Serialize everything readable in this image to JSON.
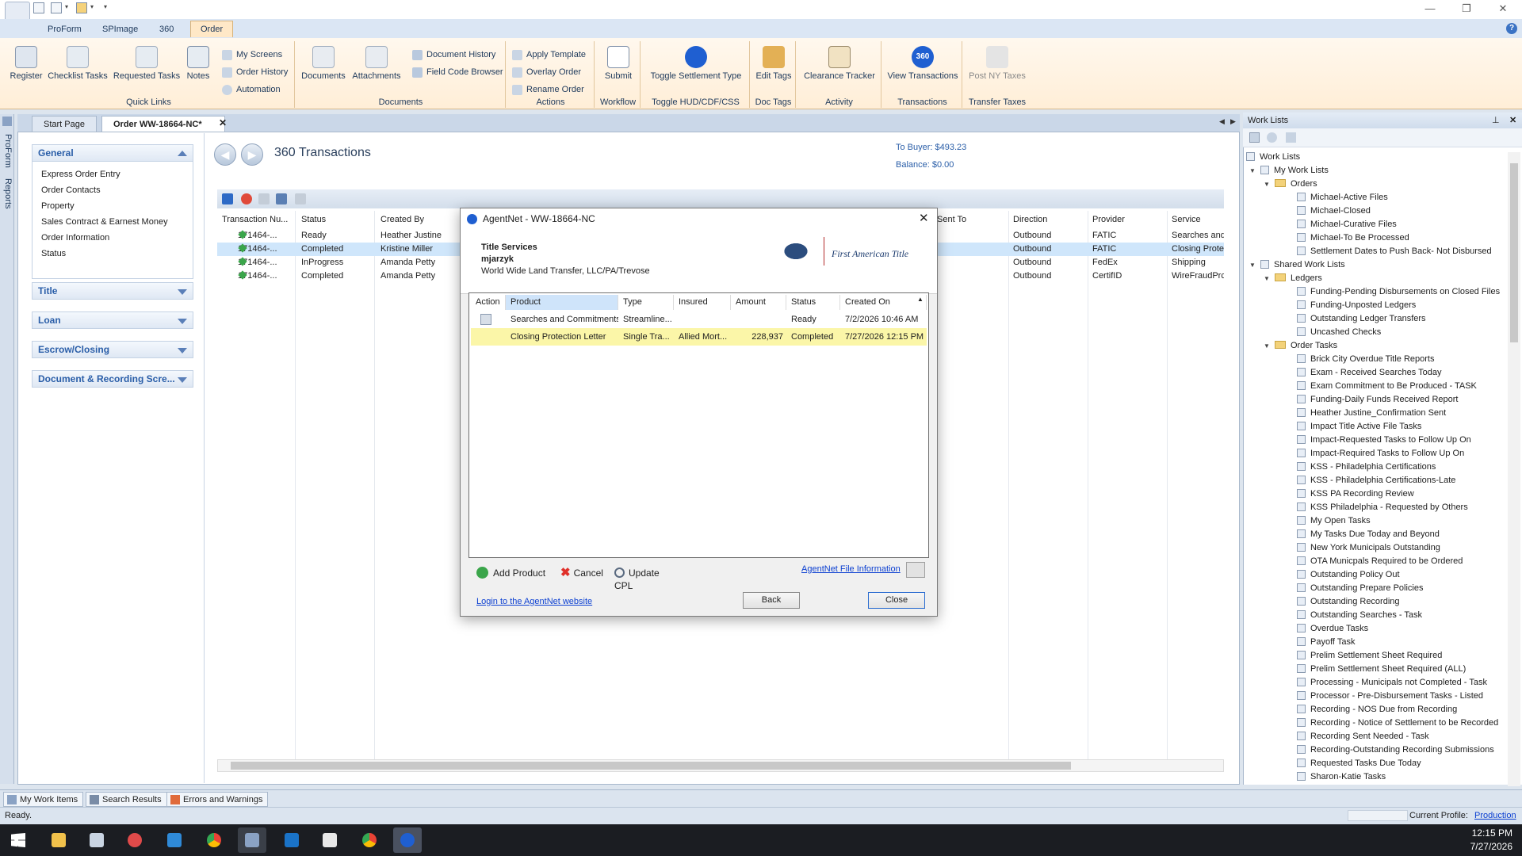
{
  "ribbon_tabs": [
    "ProForm",
    "SPImage",
    "360",
    "Order"
  ],
  "ribbon": {
    "quick_links": {
      "label": "Quick Links",
      "register": "Register",
      "checklist": "Checklist Tasks",
      "requested": "Requested Tasks",
      "notes": "Notes",
      "my_screens": "My Screens",
      "order_history": "Order History",
      "automation": "Automation"
    },
    "documents": {
      "label": "Documents",
      "documents": "Documents",
      "attachments": "Attachments",
      "doc_history": "Document History",
      "field_code": "Field Code Browser"
    },
    "actions": {
      "label": "Actions",
      "apply_template": "Apply Template",
      "overlay_order": "Overlay Order",
      "rename_order": "Rename Order"
    },
    "workflow": {
      "label": "Workflow",
      "submit": "Submit"
    },
    "toggle": {
      "label": "Toggle HUD/CDF/CSS",
      "btn": "Toggle Settlement Type"
    },
    "doc_tags": {
      "label": "Doc Tags",
      "btn": "Edit Tags"
    },
    "activity": {
      "label": "Activity",
      "btn": "Clearance Tracker"
    },
    "transactions": {
      "label": "Transactions",
      "btn": "View Transactions",
      "icon_text": "360"
    },
    "transfer_taxes": {
      "label": "Transfer Taxes",
      "btn": "Post NY Taxes"
    }
  },
  "side_tabs": [
    "ProForm",
    "Reports"
  ],
  "doc_tabs": [
    "Start Page",
    "Order WW-18664-NC*"
  ],
  "nav": {
    "general": {
      "title": "General",
      "items": [
        "Express Order Entry",
        "Order Contacts",
        "Property",
        "Sales Contract & Earnest Money",
        "Order Information",
        "Status"
      ]
    },
    "title": "Title",
    "loan": "Loan",
    "escrow": "Escrow/Closing",
    "docrec": "Document & Recording Scre..."
  },
  "content": {
    "title": "360 Transactions",
    "to_buyer": "To Buyer: $493.23",
    "balance": "Balance: $0.00"
  },
  "grid": {
    "headers": [
      "Transaction Nu...",
      "Status",
      "Created By",
      "Sent To",
      "Direction",
      "Provider",
      "Service"
    ],
    "rows": [
      {
        "num": "171464-...",
        "status": "Ready",
        "by": "Heather Justine",
        "dir": "Outbound",
        "prov": "FATIC",
        "svc": "Searches and"
      },
      {
        "num": "171464-...",
        "status": "Completed",
        "by": "Kristine Miller",
        "dir": "Outbound",
        "prov": "FATIC",
        "svc": "Closing Prote"
      },
      {
        "num": "171464-...",
        "status": "InProgress",
        "by": "Amanda Petty",
        "dir": "Outbound",
        "prov": "FedEx",
        "svc": "Shipping"
      },
      {
        "num": "171464-...",
        "status": "Completed",
        "by": "Amanda Petty",
        "dir": "Outbound",
        "prov": "CertifID",
        "svc": "WireFraudPrc"
      }
    ]
  },
  "worklists": {
    "panel_title": "Work Lists",
    "root": "Work Lists",
    "my": "My Work Lists",
    "orders": "Orders",
    "order_items": [
      "Michael-Active Files",
      "Michael-Closed",
      "Michael-Curative Files",
      "Michael-To Be Processed",
      "Settlement Dates to Push Back- Not Disbursed"
    ],
    "shared": "Shared Work Lists",
    "ledgers": "Ledgers",
    "ledger_items": [
      "Funding-Pending Disbursements on Closed Files",
      "Funding-Unposted Ledgers",
      "Outstanding Ledger Transfers",
      "Uncashed Checks"
    ],
    "order_tasks": "Order Tasks",
    "task_items": [
      "Brick City Overdue Title Reports",
      "Exam - Received Searches Today",
      "Exam Commitment to Be Produced - TASK",
      "Funding-Daily Funds Received Report",
      "Heather Justine_Confirmation Sent",
      "Impact Title Active File Tasks",
      "Impact-Requested Tasks to Follow Up On",
      "Impact-Required Tasks to Follow Up On",
      "KSS - Philadelphia Certifications",
      "KSS - Philadelphia Certifications-Late",
      "KSS PA Recording Review",
      "KSS Philadelphia - Requested by Others",
      "My Open Tasks",
      "My Tasks Due Today and Beyond",
      "New York Municipals Outstanding",
      "OTA Municpals Required to be Ordered",
      "Outstanding Policy Out",
      "Outstanding Prepare Policies",
      "Outstanding Recording",
      "Outstanding Searches - Task",
      "Overdue Tasks",
      "Payoff Task",
      "Prelim Settlement Sheet Required",
      "Prelim Settlement Sheet Required (ALL)",
      "Processing - Municipals not Completed - Task",
      "Processor - Pre-Disbursement Tasks - Listed",
      "Recording - NOS Due from Recording",
      "Recording - Notice of Settlement to be Recorded",
      "Recording Sent Needed - Task",
      "Recording-Outstanding Recording Submissions",
      "Requested Tasks Due Today",
      "Sharon-Katie Tasks"
    ]
  },
  "bottom_tabs": [
    "My Work Items",
    "Search Results",
    "Errors and Warnings"
  ],
  "status": {
    "left": "Ready.",
    "profile_label": "Current Profile:",
    "profile": "Production"
  },
  "taskbar": {
    "time": "12:15 PM",
    "date": "7/27/2026"
  },
  "dialog": {
    "title": "AgentNet - WW-18664-NC",
    "section": "Title Services",
    "user": "mjarzyk",
    "company": "World Wide Land Transfer, LLC/PA/Trevose",
    "brand": "First American Title",
    "headers": [
      "Action",
      "Product",
      "Type",
      "Insured",
      "Amount",
      "Status",
      "Created On"
    ],
    "rows": [
      {
        "product": "Searches and Commitments",
        "type": "Streamline...",
        "insured": "",
        "amount": "",
        "status": "Ready",
        "created": "7/2/2026 10:46 AM"
      },
      {
        "product": "Closing Protection Letter",
        "type": "Single Tra...",
        "insured": "Allied Mort...",
        "amount": "228,937",
        "status": "Completed",
        "created": "7/27/2026 12:15 PM"
      }
    ],
    "add_product": "Add Product",
    "cancel": "Cancel",
    "update_cpl": "Update CPL",
    "file_info": "AgentNet File Information",
    "login_link": "Login to the AgentNet website",
    "back": "Back",
    "close": "Close"
  },
  "colors": {
    "accent": "#2a5ea8",
    "ribbon": "#ffeed7",
    "selected_row": "#cfe6fb",
    "dialog_selected": "#fbf6a8"
  }
}
